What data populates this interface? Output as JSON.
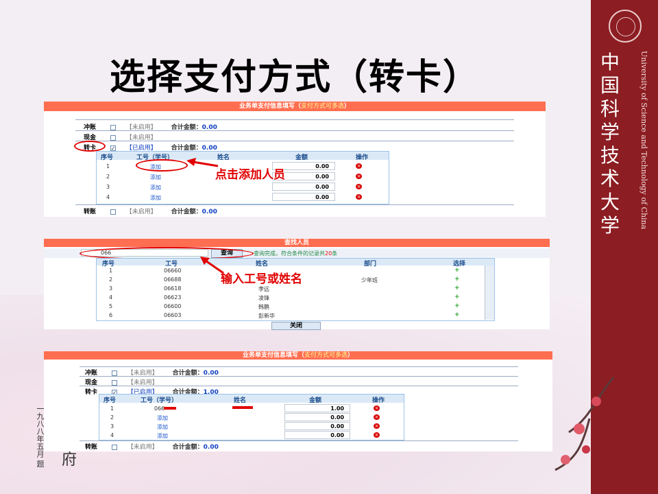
{
  "slide": {
    "title": "选择支付方式（转卡）"
  },
  "side": {
    "zh_name": "中国科学技术大学",
    "en_name": "University of Science and Technology of China"
  },
  "panel1": {
    "header": "业务单支付信息填写（",
    "header_sub": "支付方式可多选",
    "header_close": "）",
    "rows": [
      {
        "label": "冲账",
        "status": "【未启用】",
        "total_label": "合计金额：",
        "total": "0.00"
      },
      {
        "label": "现金",
        "status": "【未启用】"
      },
      {
        "label": "转卡",
        "status": "【已启用】",
        "total_label": "合计金额：",
        "total": "0.00"
      },
      {
        "label": "转账",
        "status": "【未启用】",
        "total_label": "合计金额：",
        "total": "0.00"
      }
    ],
    "columns": [
      "序号",
      "工号（学号）",
      "姓名",
      "金额",
      "操作"
    ],
    "lines": [
      {
        "no": "1",
        "action": "添加",
        "amount": "0.00"
      },
      {
        "no": "2",
        "action": "添加",
        "amount": "0.00"
      },
      {
        "no": "3",
        "action": "添加",
        "amount": "0.00"
      },
      {
        "no": "4",
        "action": "添加",
        "amount": "0.00"
      }
    ],
    "annotation": "点击添加人员"
  },
  "panel2": {
    "header": "查找人员",
    "search_value": "066",
    "search_button": "查询",
    "result_prefix": "查询完成，符合条件的记录共",
    "result_count": "20",
    "result_suffix": "条",
    "columns": [
      "序号",
      "工号",
      "姓名",
      "部门",
      "选择"
    ],
    "rows": [
      {
        "no": "1",
        "id": "06660",
        "name": "",
        "dept": ""
      },
      {
        "no": "2",
        "id": "06688",
        "name": "",
        "dept": "少年班"
      },
      {
        "no": "3",
        "id": "06618",
        "name": "李远",
        "dept": ""
      },
      {
        "no": "4",
        "id": "06623",
        "name": "凌锋",
        "dept": ""
      },
      {
        "no": "5",
        "id": "06600",
        "name": "韩鹏",
        "dept": ""
      },
      {
        "no": "6",
        "id": "06603",
        "name": "彭新华",
        "dept": ""
      }
    ],
    "select_glyph": "+",
    "close_button": "关闭",
    "annotation": "输入工号或姓名"
  },
  "panel3": {
    "header": "业务单支付信息填写（",
    "header_sub": "支付方式可多选",
    "header_close": "）",
    "rows": [
      {
        "label": "冲账",
        "status": "【未启用】",
        "total_label": "合计金额：",
        "total": "0.00"
      },
      {
        "label": "现金",
        "status": "【未启用】"
      },
      {
        "label": "转卡",
        "status": "【已启用】",
        "total_label": "合计金额：",
        "total": "1.00"
      },
      {
        "label": "转账",
        "status": "【未启用】",
        "total_label": "合计金额：",
        "total": "0.00"
      }
    ],
    "columns": [
      "序号",
      "工号（学号）",
      "姓名",
      "金额",
      "操作"
    ],
    "lines": [
      {
        "no": "1",
        "action": "066",
        "amount": "1.00"
      },
      {
        "no": "2",
        "action": "添加",
        "amount": "0.00"
      },
      {
        "no": "3",
        "action": "添加",
        "amount": "0.00"
      },
      {
        "no": "4",
        "action": "添加",
        "amount": "0.00"
      }
    ]
  },
  "calligraphy": {
    "text": "一九八八年五月 题",
    "tail": "府"
  }
}
